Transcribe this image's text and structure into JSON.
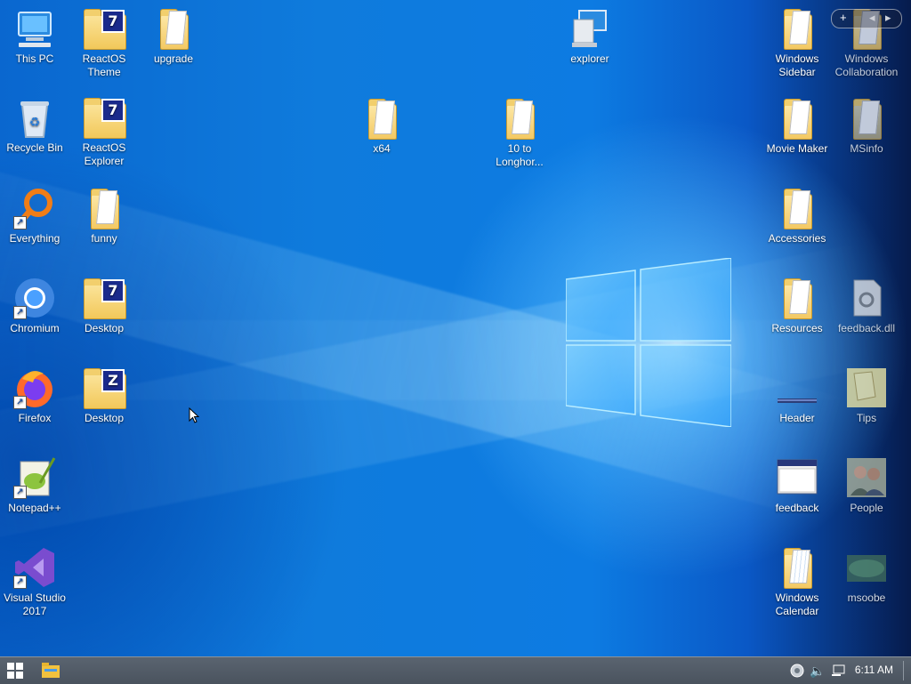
{
  "desktop": {
    "icons": [
      {
        "label": "This PC",
        "icon": "computer-icon"
      },
      {
        "label": "ReactOS\nTheme",
        "icon": "folder-7z-icon"
      },
      {
        "label": "upgrade",
        "icon": "folder-icon"
      },
      {
        "label": "explorer",
        "icon": "explorer-icon"
      },
      {
        "label": "Windows\nSidebar",
        "icon": "folder-icon"
      },
      {
        "label": "Windows\nCollaboration",
        "icon": "folder-icon"
      },
      {
        "label": "Recycle Bin",
        "icon": "recycle-bin-icon"
      },
      {
        "label": "ReactOS\nExplorer",
        "icon": "folder-7z-icon"
      },
      {
        "label": "x64",
        "icon": "folder-icon"
      },
      {
        "label": "10 to\nLonghor...",
        "icon": "folder-icon"
      },
      {
        "label": "Movie Maker",
        "icon": "folder-icon"
      },
      {
        "label": "MSinfo",
        "icon": "folder-icon"
      },
      {
        "label": "Everything",
        "icon": "everything-search-icon"
      },
      {
        "label": "funny",
        "icon": "folder-icon"
      },
      {
        "label": "Accessories",
        "icon": "folder-icon"
      },
      {
        "label": "Chromium",
        "icon": "chromium-icon"
      },
      {
        "label": "Desktop",
        "icon": "folder-7z-icon"
      },
      {
        "label": "Resources",
        "icon": "folder-icon"
      },
      {
        "label": "feedback.dll",
        "icon": "dll-file-icon"
      },
      {
        "label": "Firefox",
        "icon": "firefox-icon"
      },
      {
        "label": "Desktop",
        "icon": "folder-z-icon"
      },
      {
        "label": "Header",
        "icon": "header-image-icon"
      },
      {
        "label": "Tips",
        "icon": "tips-image-icon"
      },
      {
        "label": "Notepad++",
        "icon": "notepadpp-icon"
      },
      {
        "label": "feedback",
        "icon": "window-icon"
      },
      {
        "label": "People",
        "icon": "people-icon"
      },
      {
        "label": "Visual Studio\n2017",
        "icon": "visual-studio-icon"
      },
      {
        "label": "Windows\nCalendar",
        "icon": "calendar-folder-icon"
      },
      {
        "label": "msoobe",
        "icon": "msoobe-image-icon"
      }
    ]
  },
  "gadget": {
    "add": "+",
    "prev": "◂",
    "next": "▸"
  },
  "taskbar": {
    "clock": "6:11 AM",
    "tray_icons": [
      "network-globe-icon",
      "volume-icon",
      "network-monitor-icon"
    ]
  }
}
